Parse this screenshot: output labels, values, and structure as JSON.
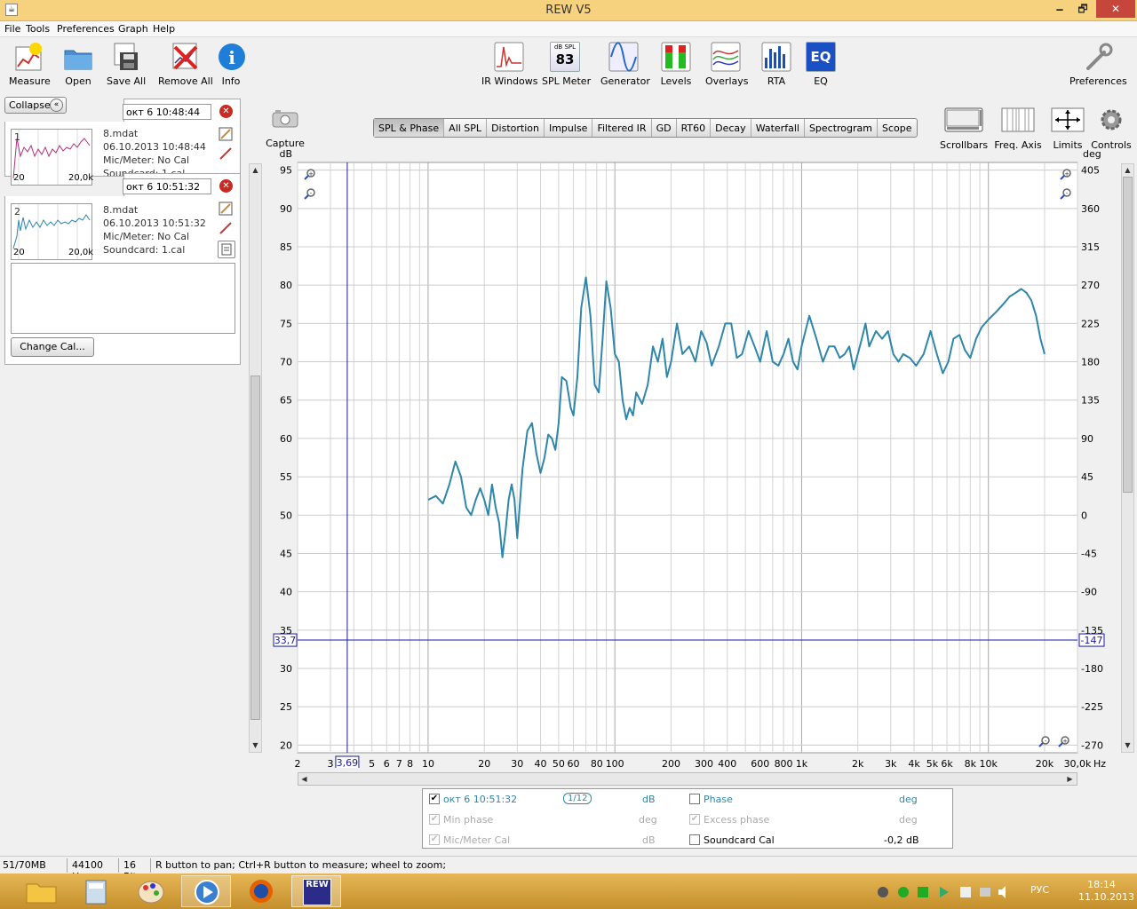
{
  "window": {
    "title": "REW V5",
    "min": "🗕",
    "max": "🗗",
    "close": "✕"
  },
  "menu": [
    "File",
    "Tools",
    "Preferences",
    "Graph",
    "Help"
  ],
  "toolbar_left": [
    {
      "label": "Measure",
      "icon": "measure-icon"
    },
    {
      "label": "Open",
      "icon": "folder-icon"
    },
    {
      "label": "Save All",
      "icon": "save-all-icon"
    },
    {
      "label": "Remove All",
      "icon": "remove-all-icon"
    },
    {
      "label": "Info",
      "icon": "info-icon"
    }
  ],
  "toolbar_center": [
    {
      "label": "IR Windows",
      "icon": "ir-windows-icon"
    },
    {
      "label": "SPL Meter",
      "icon": "spl-meter-icon",
      "top": "dB SPL",
      "value": "83"
    },
    {
      "label": "Generator",
      "icon": "generator-icon"
    },
    {
      "label": "Levels",
      "icon": "levels-icon"
    },
    {
      "label": "Overlays",
      "icon": "overlays-icon"
    },
    {
      "label": "RTA",
      "icon": "rta-icon"
    },
    {
      "label": "EQ",
      "icon": "eq-icon",
      "text": "EQ"
    }
  ],
  "preferences_label": "Preferences",
  "collapse_label": "Collapse",
  "measurements": [
    {
      "num": "1",
      "name_value": "окт 6 10:48:44",
      "file": "8.mdat",
      "date": "06.10.2013 10:48:44",
      "mic": "Mic/Meter: No Cal",
      "soundcard": "Soundcard: 1.cal",
      "xmin": "20",
      "xmax": "20,0k",
      "color": "#b0307a"
    },
    {
      "num": "2",
      "name_value": "окт 6 10:51:32",
      "file": "8.mdat",
      "date": "06.10.2013 10:51:32",
      "mic": "Mic/Meter: No Cal",
      "soundcard": "Soundcard: 1.cal",
      "xmin": "20",
      "xmax": "20,0k",
      "color": "#2e86ab"
    }
  ],
  "change_cal_label": "Change Cal...",
  "capture_label": "Capture",
  "graph_tabs": [
    "SPL & Phase",
    "All SPL",
    "Distortion",
    "Impulse",
    "Filtered IR",
    "GD",
    "RT60",
    "Decay",
    "Waterfall",
    "Spectrogram",
    "Scope"
  ],
  "right_tools": [
    {
      "label": "Scrollbars",
      "icon": "scrollbars-icon"
    },
    {
      "label": "Freq. Axis",
      "icon": "freq-axis-icon"
    },
    {
      "label": "Limits",
      "icon": "limits-icon"
    },
    {
      "label": "Controls",
      "icon": "controls-gear-icon"
    }
  ],
  "chart_data": {
    "type": "line",
    "xscale": "log",
    "xlim": [
      2,
      30000
    ],
    "ylim": [
      19,
      96
    ],
    "ylabel": "dB",
    "y2label": "deg",
    "xunit": "Hz",
    "xticks": [
      2,
      3,
      4,
      5,
      6,
      7,
      8,
      10,
      20,
      30,
      40,
      50,
      60,
      80,
      100,
      200,
      300,
      400,
      600,
      800,
      1000,
      2000,
      3000,
      4000,
      5000,
      6000,
      8000,
      10000,
      20000,
      30000
    ],
    "xtick_labels": [
      "2",
      "3",
      "",
      "5",
      "6",
      "7",
      "8",
      "10",
      "20",
      "30",
      "40",
      "50",
      "60",
      "80",
      "100",
      "200",
      "300",
      "400",
      "600",
      "800",
      "1k",
      "2k",
      "3k",
      "4k",
      "5k",
      "6k",
      "8k",
      "10k",
      "20k",
      "30,0k"
    ],
    "yticks": [
      20,
      25,
      30,
      35,
      40,
      45,
      50,
      55,
      60,
      65,
      70,
      75,
      80,
      85,
      90,
      95
    ],
    "y2ticks": [
      "-270",
      "-225",
      "-180",
      "-135",
      "-90",
      "-45",
      "0",
      "45",
      "90",
      "135",
      "180",
      "225",
      "270",
      "315",
      "360",
      "405"
    ],
    "cursor": {
      "x": 3.69,
      "x_label": "3,69",
      "y": 33.7,
      "y_label": "33,7",
      "y2_label": "-147"
    },
    "grid": true,
    "series": [
      {
        "color": "#2e86ab",
        "x": [
          10,
          11,
          12,
          13,
          14,
          15,
          16,
          17,
          18,
          19,
          20,
          21,
          22,
          23,
          24,
          25,
          26,
          27,
          28,
          29,
          30,
          32,
          34,
          36,
          38,
          40,
          42,
          44,
          46,
          48,
          50,
          52,
          55,
          58,
          60,
          63,
          66,
          70,
          74,
          78,
          82,
          86,
          90,
          95,
          100,
          105,
          110,
          115,
          120,
          125,
          130,
          140,
          150,
          160,
          170,
          180,
          190,
          200,
          215,
          230,
          250,
          270,
          290,
          310,
          330,
          360,
          390,
          420,
          450,
          480,
          520,
          560,
          600,
          650,
          700,
          750,
          800,
          850,
          900,
          950,
          1000,
          1100,
          1200,
          1300,
          1400,
          1500,
          1600,
          1700,
          1800,
          1900,
          2000,
          2100,
          2200,
          2300,
          2500,
          2700,
          2900,
          3100,
          3300,
          3500,
          3800,
          4100,
          4500,
          4900,
          5300,
          5700,
          6100,
          6500,
          7000,
          7500,
          8000,
          8600,
          9200,
          10000,
          11000,
          12000,
          13000,
          14000,
          15000,
          16000,
          17000,
          18000,
          19000,
          20000
        ],
        "y": [
          52,
          52.5,
          51.5,
          54,
          57,
          55,
          51,
          50,
          52,
          53.5,
          52,
          50,
          54,
          51,
          49,
          44.5,
          48,
          52,
          54,
          52,
          47,
          56,
          61,
          62,
          58,
          55.5,
          57.5,
          60.5,
          60,
          58.5,
          62,
          68,
          67.5,
          64,
          63,
          68,
          77,
          81,
          76,
          67,
          66,
          73,
          80.5,
          77,
          71,
          70,
          65,
          62.5,
          64,
          63,
          66,
          64.5,
          67,
          72,
          70,
          73,
          68,
          70,
          75,
          71,
          72,
          70,
          74,
          72.5,
          69.5,
          72,
          75,
          75,
          70.5,
          71,
          74,
          72,
          70,
          74,
          70,
          69.5,
          71,
          73,
          70,
          69,
          72,
          76,
          73,
          70,
          72,
          72,
          70.5,
          71,
          72,
          69,
          71,
          73,
          75,
          72,
          74,
          73,
          74,
          71,
          70,
          71,
          70.5,
          69.5,
          71,
          74,
          71,
          68.5,
          70,
          73,
          73.5,
          71.5,
          70.5,
          73,
          74.5,
          75.5,
          76.5,
          77.5,
          78.5,
          79,
          79.5,
          79,
          78,
          76,
          73,
          71
        ]
      }
    ]
  },
  "legend": {
    "name": "окт 6 10:51:32",
    "smoothing": "1/12",
    "db": "dB",
    "deg": "deg",
    "phase": "Phase",
    "min_phase": "Min phase",
    "excess_phase": "Excess phase",
    "mic_cal": "Mic/Meter Cal",
    "soundcard_cal": "Soundcard Cal",
    "soundcard_value": "-0,2 dB"
  },
  "status": {
    "memory": "51/70MB",
    "rate": "44100 Hz",
    "bits": "16 Bit",
    "hint": "R button to pan; Ctrl+R button to measure; wheel to zoom;"
  },
  "taskbar": {
    "lang": "РУС",
    "time": "18:14",
    "date": "11.10.2013",
    "rew_badge": "REW"
  }
}
